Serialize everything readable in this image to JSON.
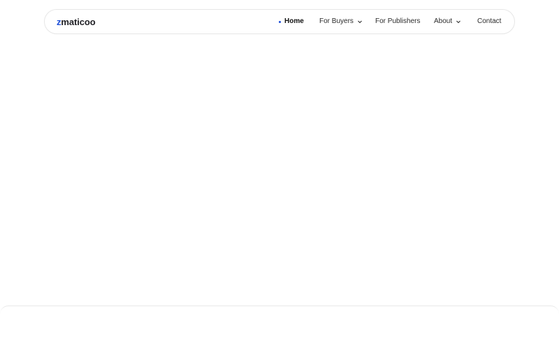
{
  "brand": {
    "logo_text": "zmaticoo"
  },
  "nav": {
    "items": [
      {
        "label": "Home",
        "active": true
      },
      {
        "label": "For Buyers",
        "dropdown": true
      },
      {
        "label": "For Publishers"
      },
      {
        "label": "About",
        "dropdown": true
      },
      {
        "label": "Contact"
      }
    ]
  },
  "colors": {
    "accent": "#1d4ed8",
    "text": "#2b2b2b",
    "border": "#e6e6e6"
  },
  "icons": {
    "active_marker": "dot-icon",
    "dropdown": "chevron-down-icon"
  }
}
